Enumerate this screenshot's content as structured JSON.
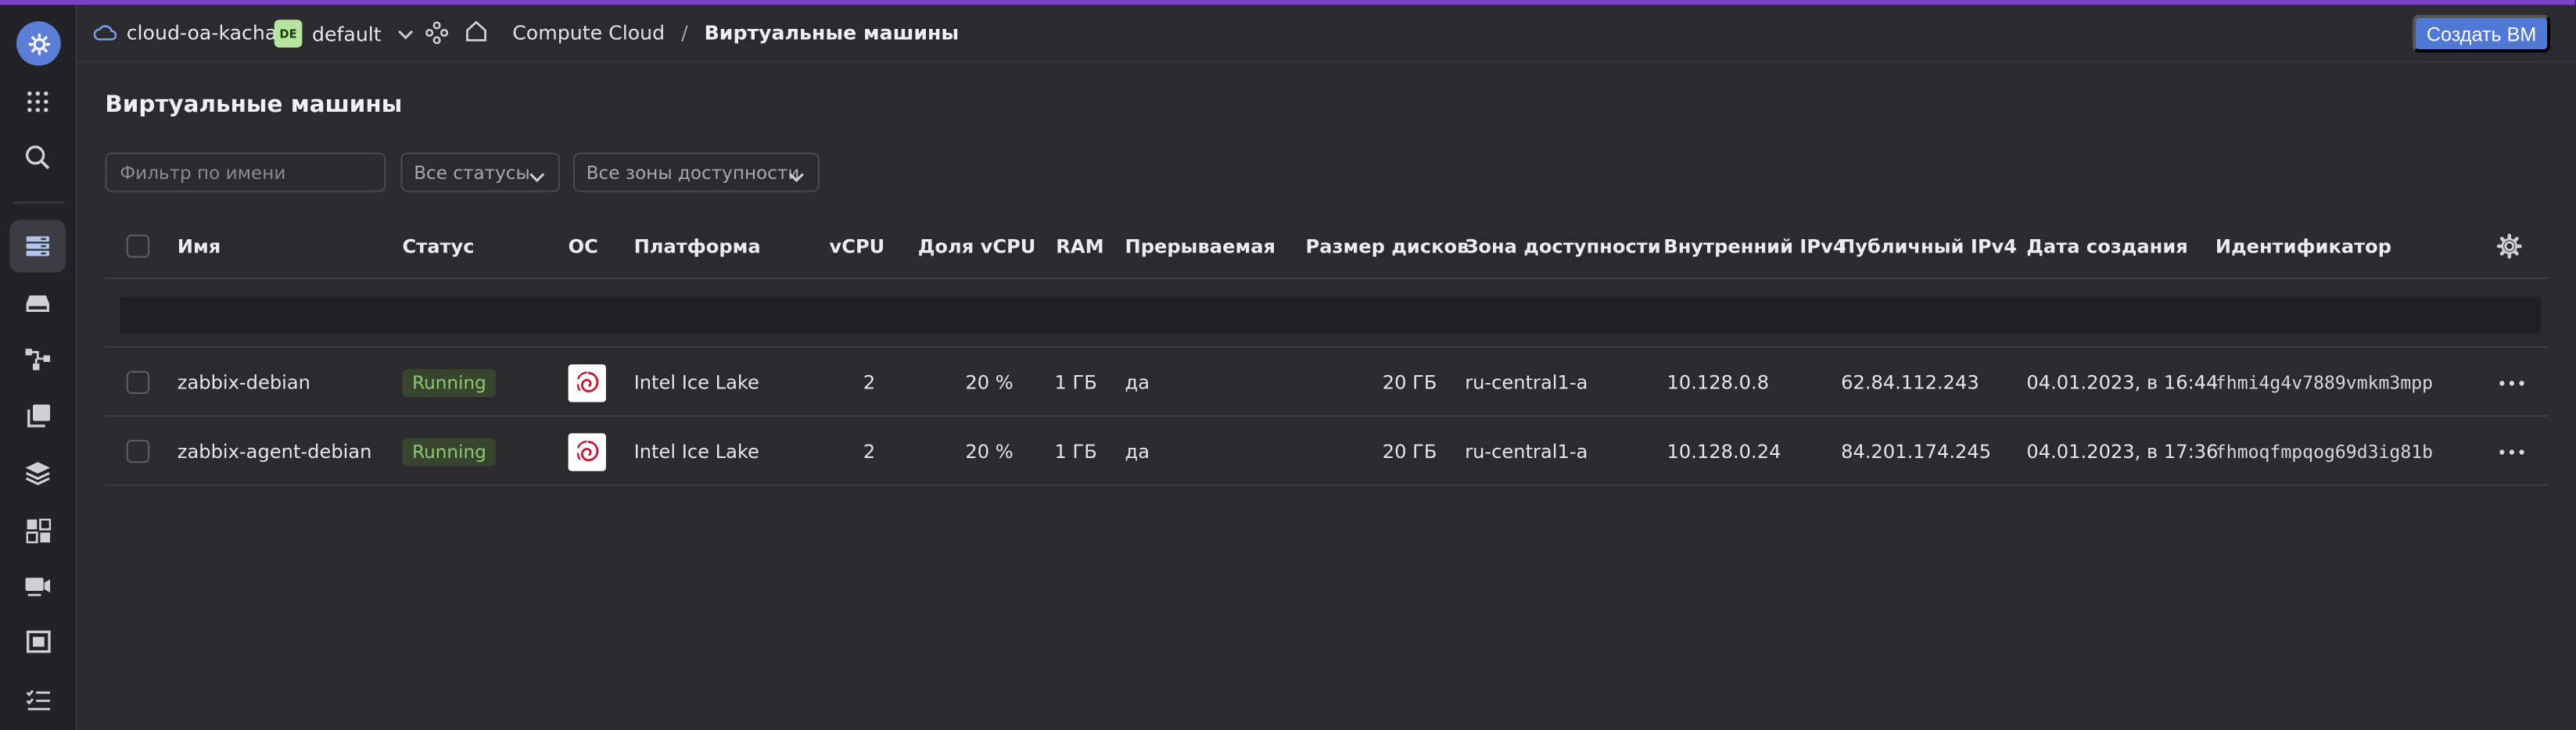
{
  "header": {
    "cloud_name": "cloud-oa-kachan",
    "folder_badge": "DE",
    "folder_name": "default",
    "breadcrumb": [
      "Compute Cloud",
      "Виртуальные машины"
    ],
    "breadcrumb_sep": "/",
    "create_button": "Создать ВМ"
  },
  "sidebar": {
    "items": [
      "logo-icon",
      "apps-grid-icon",
      "search-icon",
      "virtual-machines-icon",
      "disks-icon",
      "placement-groups-icon",
      "images-icon",
      "instance-groups-icon",
      "snapshots-icon",
      "gpu-clusters-icon",
      "file-storage-icon",
      "operations-icon"
    ]
  },
  "page": {
    "title": "Виртуальные машины",
    "filter_placeholder": "Фильтр по имени",
    "status_select": "Все статусы",
    "zone_select": "Все зоны доступности"
  },
  "table": {
    "columns": [
      "Имя",
      "Статус",
      "ОС",
      "Платформа",
      "vCPU",
      "Доля vCPU",
      "RAM",
      "Прерываемая",
      "Размер дисков",
      "Зона доступности",
      "Внутренний IPv4",
      "Публичный IPv4",
      "Дата создания",
      "Идентификатор"
    ],
    "rows": [
      {
        "name": "zabbix-debian",
        "status": "Running",
        "os": "debian",
        "platform": "Intel Ice Lake",
        "vcpu": "2",
        "vcpu_share": "20 %",
        "ram": "1 ГБ",
        "preemptible": "да",
        "disk_size": "20 ГБ",
        "zone": "ru-central1-a",
        "internal_ip": "10.128.0.8",
        "public_ip": "62.84.112.243",
        "created": "04.01.2023, в 16:44",
        "id": "fhmi4g4v7889vmkm3mpp"
      },
      {
        "name": "zabbix-agent-debian",
        "status": "Running",
        "os": "debian",
        "platform": "Intel Ice Lake",
        "vcpu": "2",
        "vcpu_share": "20 %",
        "ram": "1 ГБ",
        "preemptible": "да",
        "disk_size": "20 ГБ",
        "zone": "ru-central1-a",
        "internal_ip": "10.128.0.24",
        "public_ip": "84.201.174.245",
        "created": "04.01.2023, в 17:36",
        "id": "fhmoqfmpqog69d3ig81b"
      }
    ]
  },
  "colors": {
    "accent": "#5079d6",
    "top_line": "#7c3fc9",
    "status_running_bg": "#37452f",
    "status_running_text": "#8ec96d",
    "background": "#2b2a2f"
  }
}
